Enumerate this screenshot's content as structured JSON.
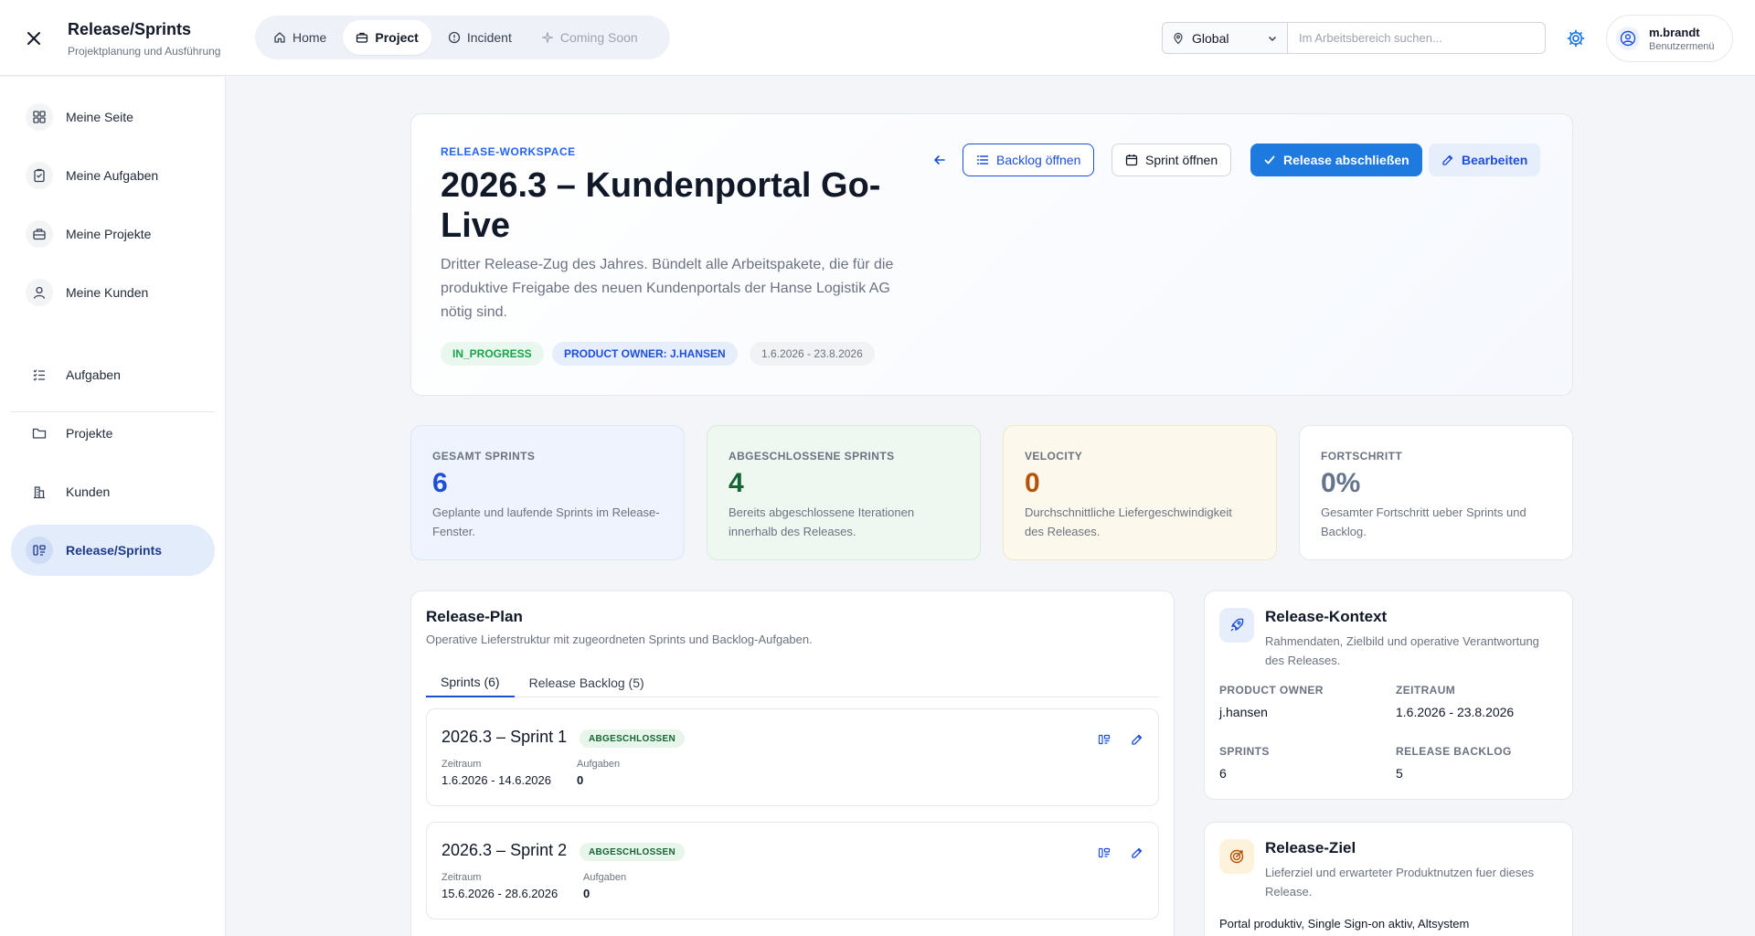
{
  "app": {
    "title": "Release/Sprints",
    "subtitle": "Projektplanung und Ausführung"
  },
  "nav": {
    "tabs": [
      {
        "label": "Home",
        "icon": "home-icon"
      },
      {
        "label": "Project",
        "icon": "briefcase-icon",
        "active": true
      },
      {
        "label": "Incident",
        "icon": "alert-circle-icon"
      },
      {
        "label": "Coming Soon",
        "icon": "sparkle-icon",
        "disabled": true
      }
    ]
  },
  "search": {
    "scope": "Global",
    "placeholder": "Im Arbeitsbereich suchen..."
  },
  "user": {
    "name": "m.brandt",
    "menu_label": "Benutzermenü"
  },
  "sidebar": {
    "items": [
      {
        "label": "Meine Seite",
        "icon": "dashboard-icon"
      },
      {
        "label": "Meine Aufgaben",
        "icon": "clipboard-icon"
      },
      {
        "label": "Meine Projekte",
        "icon": "briefcase-icon"
      },
      {
        "label": "Meine Kunden",
        "icon": "user-icon"
      },
      {
        "label": "Aufgaben",
        "icon": "checklist-icon"
      },
      {
        "label": "Projekte",
        "icon": "folder-icon"
      },
      {
        "label": "Kunden",
        "icon": "building-icon"
      },
      {
        "label": "Release/Sprints",
        "icon": "sprint-board-icon",
        "active": true
      }
    ]
  },
  "hero": {
    "eyebrow": "RELEASE-WORKSPACE",
    "title": "2026.3 – Kundenportal Go-Live",
    "description": "Dritter Release-Zug des Jahres. Bündelt alle Arbeitspakete, die für die produktive Freigabe des neuen Kundenportals der Hanse Logistik AG nötig sind.",
    "status": "IN_PROGRESS",
    "owner": "PRODUCT OWNER: J.HANSEN",
    "period": "1.6.2026 - 23.8.2026",
    "buttons": {
      "backlog": "Backlog öffnen",
      "sprint": "Sprint öffnen",
      "complete": "Release abschließen",
      "edit": "Bearbeiten"
    }
  },
  "stats": [
    {
      "label": "GESAMT SPRINTS",
      "value": "6",
      "note": "Geplante und laufende Sprints im Release-Fenster."
    },
    {
      "label": "ABGESCHLOSSENE SPRINTS",
      "value": "4",
      "note": "Bereits abgeschlossene Iterationen innerhalb des Releases."
    },
    {
      "label": "VELOCITY",
      "value": "0",
      "note": "Durchschnittliche Liefergeschwindigkeit des Releases."
    },
    {
      "label": "FORTSCHRITT",
      "value": "0%",
      "note": "Gesamter Fortschritt ueber Sprints und Backlog."
    }
  ],
  "plan": {
    "title": "Release-Plan",
    "subtitle": "Operative Lieferstruktur mit zugeordneten Sprints und Backlog-Aufgaben.",
    "tabs": [
      "Sprints (6)",
      "Release Backlog (5)"
    ],
    "field_period": "Zeitraum",
    "field_tasks": "Aufgaben",
    "sprints": [
      {
        "name": "2026.3 – Sprint 1",
        "status": "ABGESCHLOSSEN",
        "period": "1.6.2026 - 14.6.2026",
        "tasks": "0"
      },
      {
        "name": "2026.3 – Sprint 2",
        "status": "ABGESCHLOSSEN",
        "period": "15.6.2026 - 28.6.2026",
        "tasks": "0"
      }
    ]
  },
  "context": {
    "title": "Release-Kontext",
    "subtitle": "Rahmendaten, Zielbild und operative Verantwortung des Releases.",
    "owner_label": "PRODUCT OWNER",
    "owner": "j.hansen",
    "period_label": "ZEITRAUM",
    "period": "1.6.2026 - 23.8.2026",
    "sprints_label": "SPRINTS",
    "sprints": "6",
    "backlog_label": "RELEASE BACKLOG",
    "backlog": "5"
  },
  "goal": {
    "title": "Release-Ziel",
    "subtitle": "Lieferziel und erwarteter Produktnutzen fuer dieses Release.",
    "text": "Portal produktiv, Single Sign-on aktiv, Altsystem"
  },
  "colors": {
    "accent": "#1f7ae0",
    "sidebar_active": "#e3ecfb",
    "success": "#16a34a"
  }
}
